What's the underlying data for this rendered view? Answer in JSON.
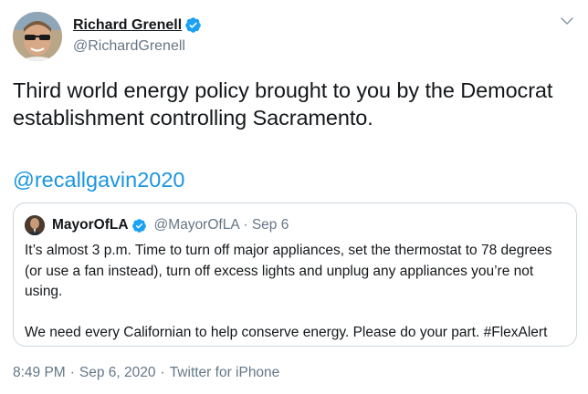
{
  "author": {
    "display_name": "Richard Grenell",
    "handle": "@RichardGrenell",
    "verified_icon": "verified-badge-icon"
  },
  "tweet": {
    "text": "Third world energy policy brought to you by the Democrat establishment controlling Sacramento.",
    "hashtag_link": "@recallgavin2020"
  },
  "quoted_tweet": {
    "display_name": "MayorOfLA",
    "handle": "@MayorOfLA",
    "separator": "·",
    "date": "Sep 6",
    "paragraph1": "It’s almost 3 p.m. Time to turn off major appliances, set the thermostat to 78 degrees (or use a fan instead), turn off excess lights and unplug any appliances you’re not using.",
    "paragraph2": "We need every Californian to help conserve energy. Please do your part. #FlexAlert"
  },
  "footer": {
    "time": "8:49 PM",
    "separator1": "·",
    "date": "Sep 6, 2020",
    "separator2": "·",
    "source": "Twitter for iPhone"
  },
  "colors": {
    "link_blue": "#1b95e0",
    "muted_gray": "#657786",
    "text_dark": "#14171a",
    "border": "#ccd6dd",
    "verified_blue": "#1da1f2"
  }
}
